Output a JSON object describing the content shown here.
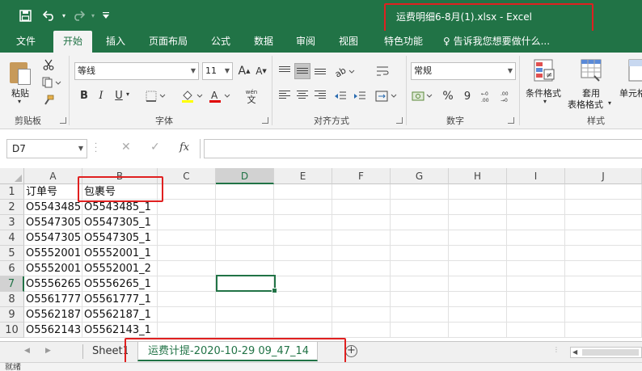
{
  "window": {
    "title": "运费明细6-8月(1).xlsx - Excel"
  },
  "qat": {
    "save_icon": "save-icon",
    "undo_icon": "undo-icon",
    "redo_icon": "redo-icon",
    "customize_icon": "customize-qat-icon"
  },
  "tabs": [
    {
      "label": "文件"
    },
    {
      "label": "开始"
    },
    {
      "label": "插入"
    },
    {
      "label": "页面布局"
    },
    {
      "label": "公式"
    },
    {
      "label": "数据"
    },
    {
      "label": "审阅"
    },
    {
      "label": "视图"
    },
    {
      "label": "特色功能"
    }
  ],
  "tell_me": "♀ 告诉我您想要做什么...",
  "ribbon": {
    "clipboard": {
      "paste_label": "粘贴",
      "group_label": "剪贴板"
    },
    "font": {
      "font_name": "等线",
      "font_size": "11",
      "grow": "A",
      "shrink": "A",
      "bold": "B",
      "italic": "I",
      "underline": "U",
      "group_label": "字体",
      "wen": "wén",
      "wen_char": "文"
    },
    "alignment": {
      "group_label": "对齐方式"
    },
    "number": {
      "format": "常规",
      "percent": "%",
      "comma": "9",
      "group_label": "数字"
    },
    "styles": {
      "cond_format": "条件格式",
      "table_format_1": "套用",
      "table_format_2": "表格格式",
      "cell_style": "单元格",
      "group_label": "样式"
    }
  },
  "formula_bar": {
    "name_box": "D7",
    "fx": "fx",
    "cancel": "✕",
    "confirm": "✓",
    "formula": ""
  },
  "columns": [
    "A",
    "B",
    "C",
    "D",
    "E",
    "F",
    "G",
    "H",
    "I",
    "J"
  ],
  "rows": [
    {
      "num": "1",
      "a": "订单号",
      "b": "包裹号"
    },
    {
      "num": "2",
      "a": "O5543485",
      "b": "O5543485_1"
    },
    {
      "num": "3",
      "a": "O5547305",
      "b": "O5547305_1"
    },
    {
      "num": "4",
      "a": "O5547305",
      "b": "O5547305_1"
    },
    {
      "num": "5",
      "a": "O5552001",
      "b": "O5552001_1"
    },
    {
      "num": "6",
      "a": "O5552001",
      "b": "O5552001_2"
    },
    {
      "num": "7",
      "a": "O5556265",
      "b": "O5556265_1"
    },
    {
      "num": "8",
      "a": "O5561777",
      "b": "O5561777_1"
    },
    {
      "num": "9",
      "a": "O5562187",
      "b": "O5562187_1"
    },
    {
      "num": "10",
      "a": "O5562143",
      "b": "O5562143_1"
    }
  ],
  "sheets": [
    {
      "name": "Sheet1"
    },
    {
      "name": "运费计提-2020-10-29 09_47_14"
    }
  ],
  "status": {
    "ready": "就绪"
  },
  "colors": {
    "excel_green": "#217346",
    "highlight_red": "#e02020"
  }
}
